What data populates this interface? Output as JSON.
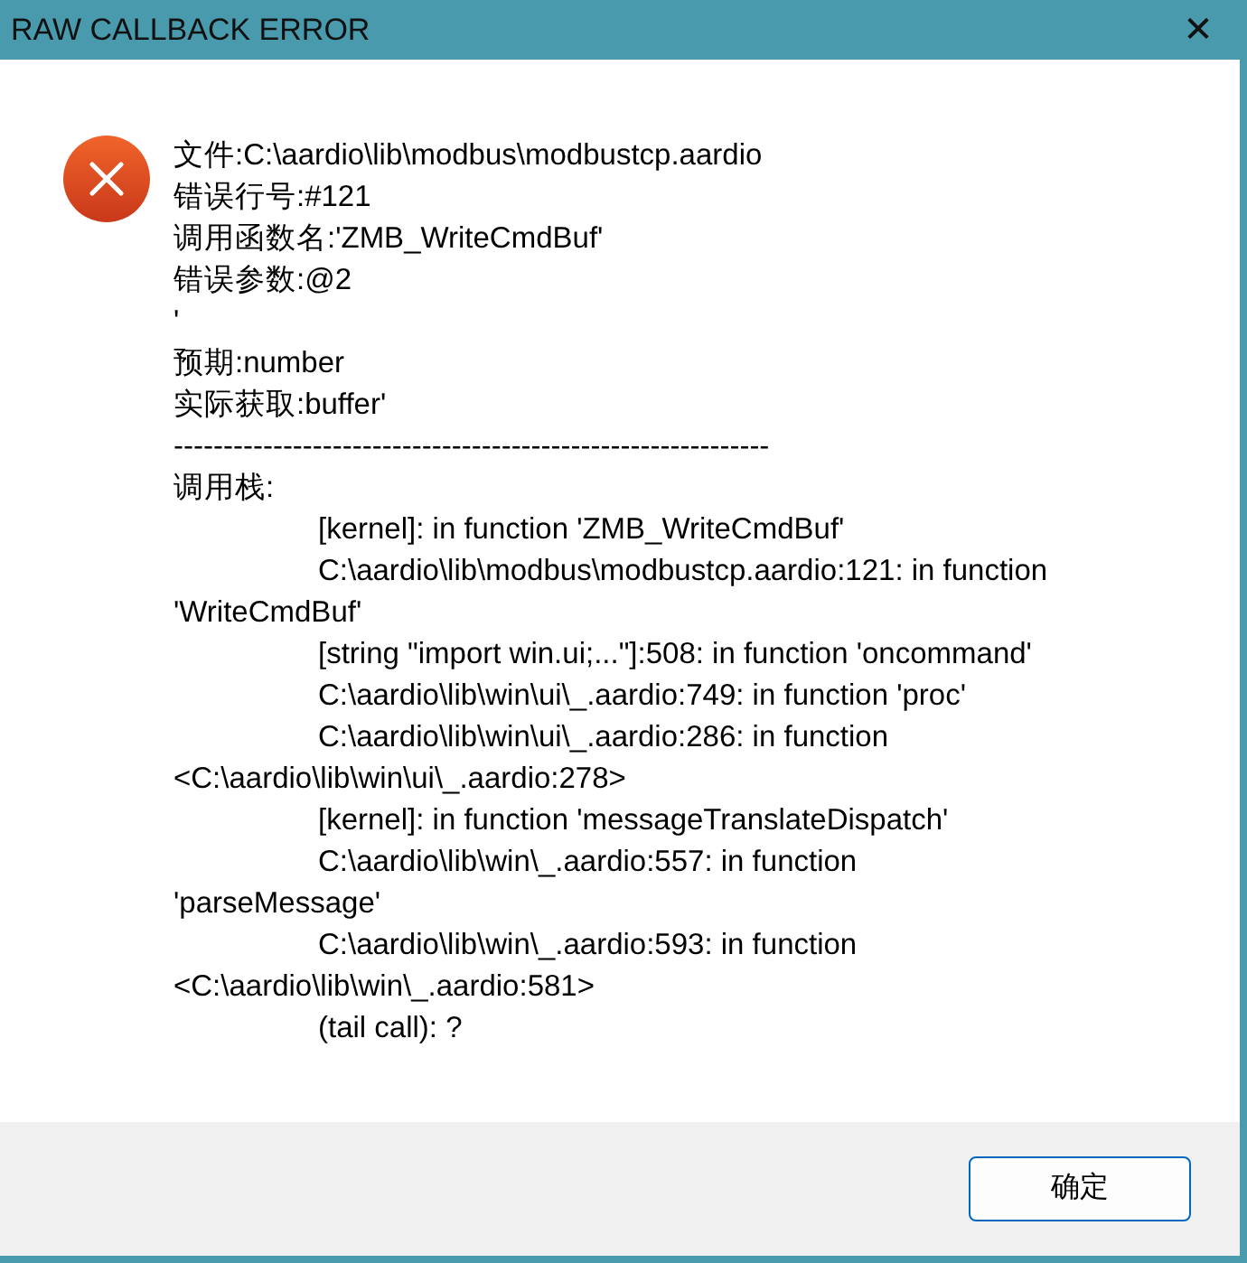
{
  "window": {
    "title": "RAW CALLBACK ERROR",
    "close": "✕"
  },
  "message": [
    {
      "text": "文件:C:\\aardio\\lib\\modbus\\modbustcp.aardio",
      "indent": false
    },
    {
      "text": "错误行号:#121",
      "indent": false
    },
    {
      "text": "调用函数名:'ZMB_WriteCmdBuf'",
      "indent": false
    },
    {
      "text": "错误参数:@2",
      "indent": false
    },
    {
      "text": "'",
      "indent": false
    },
    {
      "text": "预期:number",
      "indent": false
    },
    {
      "text": "实际获取:buffer'",
      "indent": false
    },
    {
      "text": "------------------------------------------------------------",
      "indent": false
    },
    {
      "text": "调用栈:",
      "indent": false
    },
    {
      "text": "[kernel]: in function 'ZMB_WriteCmdBuf'",
      "indent": true
    },
    {
      "text": "C:\\aardio\\lib\\modbus\\modbustcp.aardio:121: in function",
      "indent": true
    },
    {
      "text": "'WriteCmdBuf'",
      "indent": false
    },
    {
      "text": "[string \"import win.ui;...\"]:508: in function 'oncommand'",
      "indent": true
    },
    {
      "text": "C:\\aardio\\lib\\win\\ui\\_.aardio:749: in function 'proc'",
      "indent": true
    },
    {
      "text": "C:\\aardio\\lib\\win\\ui\\_.aardio:286: in function",
      "indent": true
    },
    {
      "text": "<C:\\aardio\\lib\\win\\ui\\_.aardio:278>",
      "indent": false
    },
    {
      "text": "[kernel]: in function 'messageTranslateDispatch'",
      "indent": true
    },
    {
      "text": "C:\\aardio\\lib\\win\\_.aardio:557: in function",
      "indent": true
    },
    {
      "text": "'parseMessage'",
      "indent": false
    },
    {
      "text": "C:\\aardio\\lib\\win\\_.aardio:593: in function",
      "indent": true
    },
    {
      "text": "<C:\\aardio\\lib\\win\\_.aardio:581>",
      "indent": false
    },
    {
      "text": "(tail call): ?",
      "indent": true
    }
  ],
  "buttons": [
    "确定"
  ]
}
